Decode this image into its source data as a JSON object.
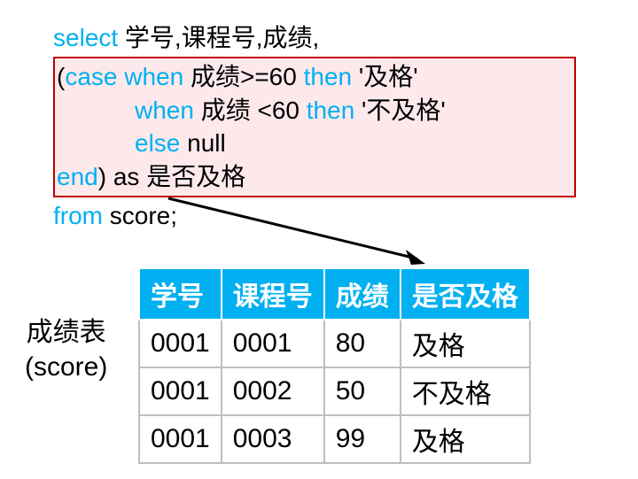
{
  "sql": {
    "select": "select",
    "select_cols": " 学号,课程号,成绩,",
    "lparen": "(",
    "case": "case",
    "when1a": " when",
    "cond1": " 成绩>=60 ",
    "then1": "then",
    "val1": " '及格'",
    "when2": "when",
    "cond2": " 成绩  <60 ",
    "then2": "then",
    "val2": " '不及格'",
    "else": "else",
    "elseval": " null",
    "end": "end",
    "rparen_as": ")  as ",
    "alias": "是否及格",
    "from": "from",
    "table": " score;"
  },
  "table_label_line1": "成绩表",
  "table_label_line2": "(score)",
  "headers": {
    "h1": "学号",
    "h2": "课程号",
    "h3": "成绩",
    "h4": "是否及格"
  },
  "rows": [
    {
      "c1": "0001",
      "c2": "0001",
      "c3": "80",
      "c4": "及格"
    },
    {
      "c1": "0001",
      "c2": "0002",
      "c3": "50",
      "c4": "不及格"
    },
    {
      "c1": "0001",
      "c2": "0003",
      "c3": "99",
      "c4": "及格"
    }
  ]
}
